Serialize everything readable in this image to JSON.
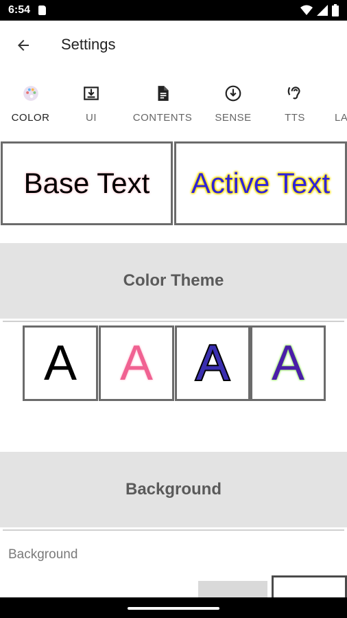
{
  "status_bar": {
    "time": "6:54",
    "icons": [
      "sim-card-icon",
      "wifi-icon",
      "signal-icon",
      "battery-icon"
    ]
  },
  "app_bar": {
    "back_icon": "arrow-back-icon",
    "title": "Settings"
  },
  "tabs": [
    {
      "label": "COLOR",
      "icon": "palette-icon",
      "active": true
    },
    {
      "label": "UI",
      "icon": "download-box-icon",
      "active": false
    },
    {
      "label": "CONTENTS",
      "icon": "document-icon",
      "active": false
    },
    {
      "label": "SENSE",
      "icon": "arrow-down-circle-icon",
      "active": false
    },
    {
      "label": "TTS",
      "icon": "hearing-icon",
      "active": false
    },
    {
      "label": "LA",
      "icon": "",
      "active": false
    }
  ],
  "preview": {
    "base_text": "Base Text",
    "active_text": "Active Text"
  },
  "sections": {
    "color_theme": "Color Theme",
    "background": "Background"
  },
  "color_themes": [
    {
      "letter": "A",
      "color": "#000000",
      "outline": "none"
    },
    {
      "letter": "A",
      "color": "#f06292",
      "outline": "#ffd6e0"
    },
    {
      "letter": "A",
      "color": "#3a2fb0",
      "outline": "#000000"
    },
    {
      "letter": "A",
      "color": "#4a1ea8",
      "outline": "#a8f07a"
    }
  ],
  "background": {
    "label": "Background"
  },
  "colors": {
    "tab_indicator": "#7fa7c9",
    "section_bg": "#e3e3e3",
    "section_text": "#5a5a5a",
    "active_text_color": "#2f24d8",
    "active_text_glow": "#ffe100"
  }
}
